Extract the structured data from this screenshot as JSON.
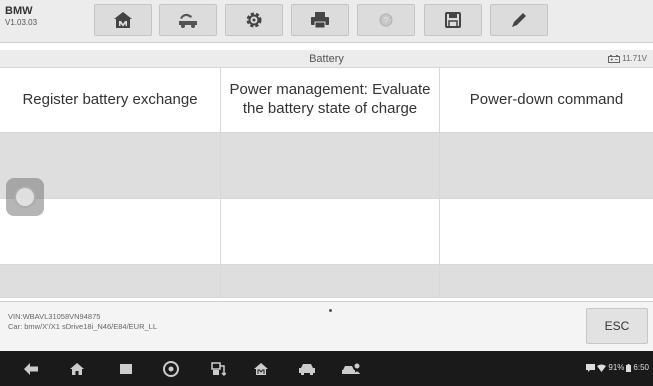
{
  "app": {
    "name": "BMW",
    "version": "V1.03.03"
  },
  "toolbar": {
    "buttons": [
      {
        "name": "home",
        "icon": "home-icon"
      },
      {
        "name": "vehicle-swap",
        "icon": "car-swap-icon"
      },
      {
        "name": "settings",
        "icon": "gear-icon"
      },
      {
        "name": "print",
        "icon": "printer-icon"
      },
      {
        "name": "help",
        "icon": "help-icon"
      },
      {
        "name": "save",
        "icon": "save-icon"
      },
      {
        "name": "edit",
        "icon": "pen-icon"
      }
    ]
  },
  "section": {
    "title": "Battery",
    "voltage": "11.71V"
  },
  "functions": [
    {
      "label": "Register battery exchange"
    },
    {
      "label": "Power management: Evaluate the battery state of charge"
    },
    {
      "label": "Power-down command"
    }
  ],
  "footer": {
    "vin": "VIN:WBAVL31058VN94875",
    "car": "Car: bmw/X'/X1 sDrive18i_N46/E84/EUR_LL",
    "esc_label": "ESC"
  },
  "status_bar": {
    "battery": "91%",
    "time": "6:50"
  },
  "colors": {
    "toolbar_bg": "#ececec",
    "row_shade": "#dedede",
    "navbar_bg": "#1a1a1a"
  }
}
